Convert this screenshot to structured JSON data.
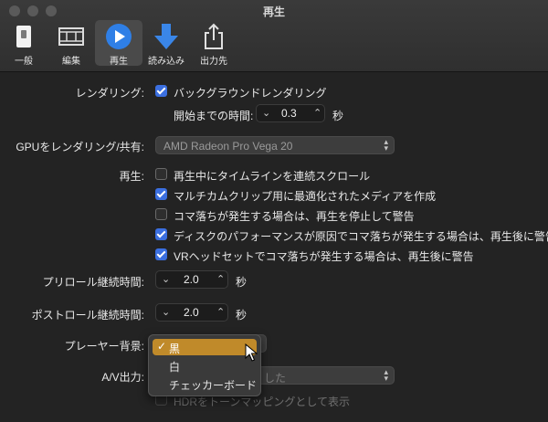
{
  "window": {
    "title": "再生"
  },
  "toolbar": {
    "items": [
      {
        "label": "一般",
        "icon": "switch-icon"
      },
      {
        "label": "編集",
        "icon": "film-icon"
      },
      {
        "label": "再生",
        "icon": "play-icon",
        "active": true
      },
      {
        "label": "読み込み",
        "icon": "import-arrow-icon"
      },
      {
        "label": "出力先",
        "icon": "share-icon"
      }
    ]
  },
  "rendering": {
    "label": "レンダリング:",
    "background_rendering": {
      "label": "バックグラウンドレンダリング",
      "checked": true
    },
    "start_delay": {
      "label": "開始までの時間:",
      "value": "0.3",
      "unit": "秒"
    }
  },
  "gpu": {
    "label": "GPUをレンダリング/共有:",
    "value": "AMD Radeon Pro Vega 20"
  },
  "playback": {
    "label": "再生:",
    "options": [
      {
        "label": "再生中にタイムラインを連続スクロール",
        "checked": false
      },
      {
        "label": "マルチカムクリップ用に最適化されたメディアを作成",
        "checked": true
      },
      {
        "label": "コマ落ちが発生する場合は、再生を停止して警告",
        "checked": false
      },
      {
        "label": "ディスクのパフォーマンスが原因でコマ落ちが発生する場合は、再生後に警告",
        "checked": true
      },
      {
        "label": "VRヘッドセットでコマ落ちが発生する場合は、再生後に警告",
        "checked": true
      }
    ]
  },
  "preroll": {
    "label": "プリロール継続時間:",
    "value": "2.0",
    "unit": "秒"
  },
  "postroll": {
    "label": "ポストロール継続時間:",
    "value": "2.0",
    "unit": "秒"
  },
  "player_background": {
    "label": "プレーヤー背景:",
    "options": [
      "黒",
      "白",
      "チェッカーボード"
    ],
    "selected": "黒",
    "check": "✓"
  },
  "av_output": {
    "label": "A/V出力:",
    "partial_value": "した"
  },
  "hdr": {
    "label": "HDRをトーンマッピングとして表示"
  },
  "colors": {
    "accent": "#3b6fe0",
    "menu_selection": "#c08a2a"
  }
}
